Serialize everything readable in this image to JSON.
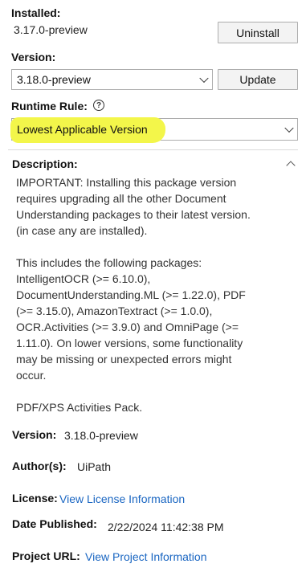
{
  "installed": {
    "label": "Installed:",
    "value": "3.17.0-preview",
    "uninstall_label": "Uninstall"
  },
  "version": {
    "label": "Version:",
    "selected": "3.18.0-preview",
    "update_label": "Update"
  },
  "runtime_rule": {
    "label": "Runtime Rule:",
    "help_glyph": "?",
    "selected": "Lowest Applicable Version",
    "highlight_color": "#f3f64a"
  },
  "details": {
    "description_label": "Description:",
    "description_p1": "IMPORTANT: Installing this package version\nrequires upgrading all the other Document\nUnderstanding packages to their latest version.\n(in case any are installed).",
    "description_p2": "This includes the following packages:\nIntelligentOCR (>= 6.10.0),\nDocumentUnderstanding.ML (>= 1.22.0), PDF\n(>= 3.15.0), AmazonTextract (>= 1.0.0),\nOCR.Activities (>= 3.9.0) and OmniPage (>=\n1.11.0). On lower versions, some functionality\nmay be missing or unexpected errors might\noccur.",
    "description_p3": "PDF/XPS Activities Pack.",
    "version_label": "Version:",
    "version_value": "3.18.0-preview",
    "authors_label": "Author(s):",
    "authors_value": "UiPath",
    "license_label": "License:",
    "license_link": "View License Information",
    "date_label": "Date Published:",
    "date_value": "2/22/2024 11:42:38 PM",
    "project_label": "Project URL:",
    "project_link": "View Project Information"
  }
}
